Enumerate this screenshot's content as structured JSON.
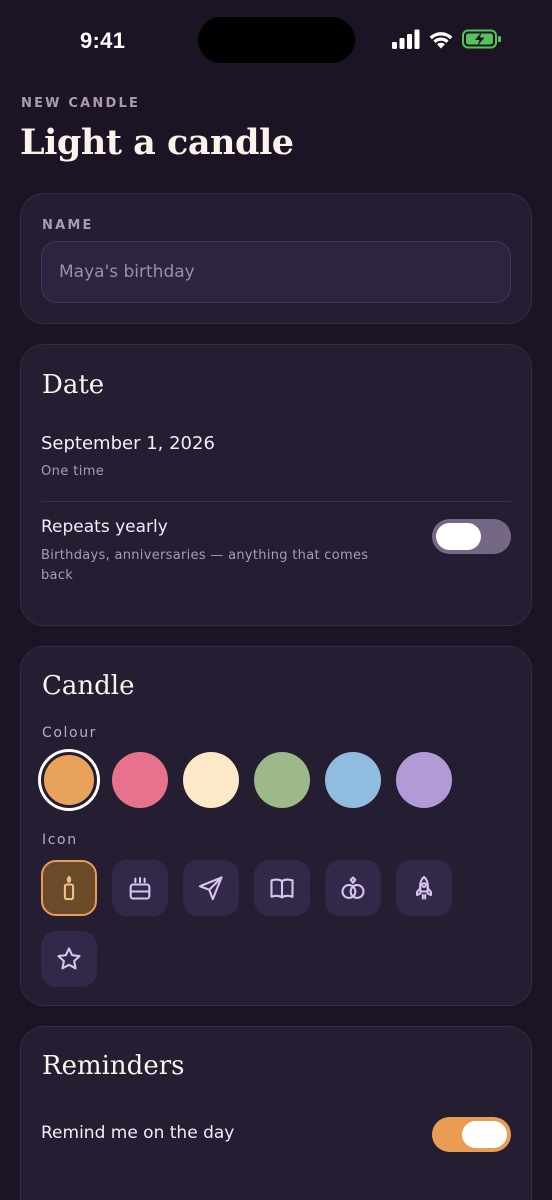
{
  "status_bar": {
    "time": "9:41",
    "icons": [
      "cellular-signal-icon",
      "wifi-icon",
      "battery-charging-icon"
    ]
  },
  "header": {
    "eyebrow": "NEW CANDLE",
    "title": "Light a candle"
  },
  "name_card": {
    "label": "NAME",
    "placeholder": "Maya's birthday",
    "value": ""
  },
  "date_card": {
    "title": "Date",
    "date_value": "September 1, 2026",
    "date_sub": "One time",
    "repeat_label": "Repeats yearly",
    "repeat_sub": "Birthdays, anniversaries — anything that comes back",
    "repeat_enabled": false
  },
  "candle_card": {
    "title": "Candle",
    "colour_label": "Colour",
    "colours": [
      "#e8a25a",
      "#e8728e",
      "#fde8c8",
      "#9db98a",
      "#90bce0",
      "#b39ad6"
    ],
    "selected_colour_index": 0,
    "icon_label": "Icon",
    "icons": [
      "candle-icon",
      "cake-icon",
      "paper-plane-icon",
      "book-icon",
      "rings-icon",
      "rocket-icon",
      "star-icon"
    ],
    "selected_icon_index": 0
  },
  "reminders_card": {
    "title": "Reminders",
    "remind_label": "Remind me on the day",
    "remind_enabled": true
  },
  "colors": {
    "accent": "#e89c54",
    "background": "#1c1424",
    "card": "#251d31"
  }
}
